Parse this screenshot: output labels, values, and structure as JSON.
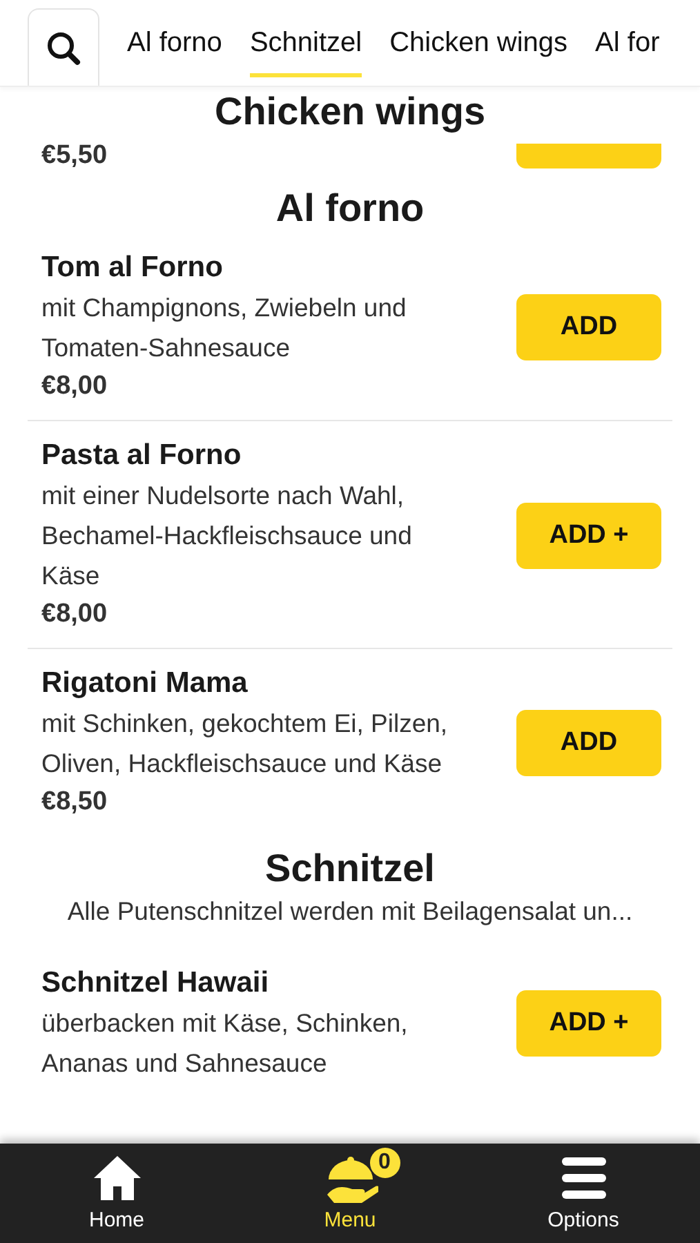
{
  "tabs": [
    {
      "label": "Al forno",
      "selected": false
    },
    {
      "label": "Schnitzel",
      "selected": true
    },
    {
      "label": "Chicken wings",
      "selected": false
    },
    {
      "label": "Al for",
      "selected": false
    }
  ],
  "sections": [
    {
      "title": "Chicken wings",
      "items": [
        {
          "price": "€5,50"
        }
      ]
    },
    {
      "title": "Al forno",
      "items": [
        {
          "name": "Tom al Forno",
          "description": "mit Champignons, Zwiebeln und Tomaten-Sahnesauce",
          "price": "€8,00",
          "button": "ADD"
        },
        {
          "name": "Pasta al Forno",
          "description": "mit einer Nudelsorte nach Wahl, Bechamel-Hackfleischsauce und Käse",
          "price": "€8,00",
          "button": "ADD +"
        },
        {
          "name": "Rigatoni Mama",
          "description": "mit Schinken, gekochtem Ei, Pilzen, Oliven, Hackfleischsauce und Käse",
          "price": "€8,50",
          "button": "ADD"
        }
      ]
    },
    {
      "title": "Schnitzel",
      "note": "Alle Putenschnitzel werden mit Beilagensalat un...",
      "items": [
        {
          "name": "Schnitzel Hawaii",
          "description": "überbacken mit Käse, Schinken, Ananas und Sahnesauce",
          "button": "ADD +"
        }
      ]
    }
  ],
  "nav": [
    {
      "kind": "home",
      "label": "Home",
      "selected": false
    },
    {
      "kind": "menu",
      "label": "Menu",
      "selected": true,
      "badge": "0"
    },
    {
      "kind": "options",
      "label": "Options",
      "selected": false
    }
  ]
}
